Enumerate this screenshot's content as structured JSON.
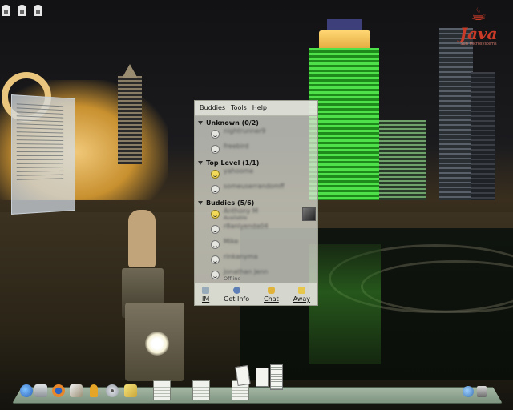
{
  "desktop": {
    "java_logo": {
      "label": "Java",
      "subtitle": "Sun Microsystems"
    },
    "top_icons": [
      "lock-icon",
      "lock-icon",
      "lock-icon"
    ]
  },
  "buddy_list": {
    "menu": [
      "Buddies",
      "Tools",
      "Help"
    ],
    "groups": [
      {
        "name": "Unknown (0/2)",
        "buddies": [
          {
            "name": "nightrunner9",
            "status": "",
            "blurred": true,
            "active": false
          },
          {
            "name": "freebird",
            "status": "",
            "blurred": true,
            "active": false
          }
        ]
      },
      {
        "name": "Top Level (1/1)",
        "buddies": [
          {
            "name": "yahoome",
            "status": "",
            "blurred": true,
            "active": true
          },
          {
            "name": "someuserrandomff",
            "status": "",
            "blurred": true,
            "active": false
          }
        ]
      },
      {
        "name": "Buddies (5/6)",
        "buddies": [
          {
            "name": "Anthony M",
            "status": "Available",
            "blurred": true,
            "active": true
          },
          {
            "name": "r8anlyenda04",
            "status": "",
            "blurred": true,
            "active": false
          },
          {
            "name": "Mike",
            "status": "",
            "blurred": true,
            "active": false
          },
          {
            "name": "rinkanyma",
            "status": "",
            "blurred": true,
            "active": false
          },
          {
            "name": "Jonathan Jenn",
            "status": "Offline",
            "blurred": true,
            "active": false
          }
        ]
      }
    ],
    "buttons": [
      {
        "label": "IM",
        "icon": "message-icon"
      },
      {
        "label": "Get Info",
        "icon": "info-icon"
      },
      {
        "label": "Chat",
        "icon": "chat-icon"
      },
      {
        "label": "Away",
        "icon": "away-icon"
      }
    ]
  },
  "panel": {
    "launchers": [
      "network-globe-icon",
      "terminal-icon",
      "firefox-icon",
      "text-editor-icon",
      "user-icon",
      "cd-player-icon",
      "notes-icon"
    ],
    "workspaces": [
      "workspace-1",
      "workspace-2",
      "workspace-3"
    ],
    "tray": [
      "network-icon",
      "user-switch-icon"
    ]
  }
}
